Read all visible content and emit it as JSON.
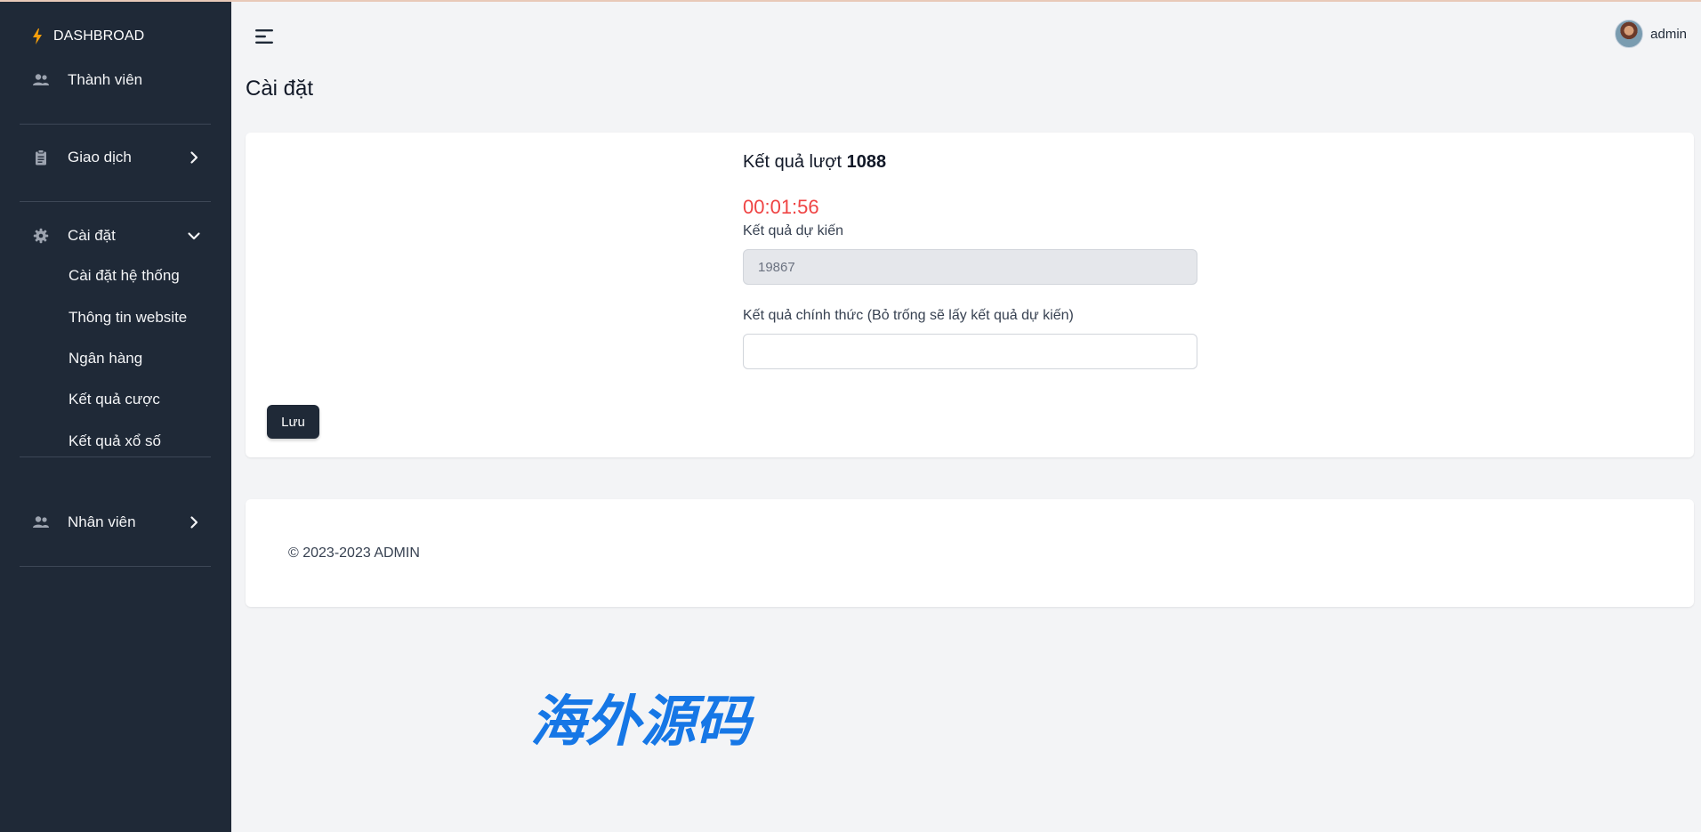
{
  "sidebar": {
    "brand": "DASHBROAD",
    "items": [
      {
        "label": "Thành viên",
        "icon": "users-icon"
      },
      {
        "label": "Giao dịch",
        "icon": "clipboard-icon",
        "chevron": "chevron-right-icon"
      },
      {
        "label": "Cài đặt",
        "icon": "gear-icon",
        "chevron": "chevron-down-icon",
        "children": [
          "Cài đặt hệ thống",
          "Thông tin website",
          "Ngân hàng",
          "Kết quả cược",
          "Kết quả xổ số"
        ]
      },
      {
        "label": "Nhân viên",
        "icon": "users-icon",
        "chevron": "chevron-right-icon"
      }
    ]
  },
  "header": {
    "user_name": "admin"
  },
  "page": {
    "title": "Cài đặt"
  },
  "result_card": {
    "title_prefix": "Kết quả lượt",
    "round_number": "1088",
    "countdown": "00:01:56",
    "expected_label": "Kết quả dự kiến",
    "expected_value": "19867",
    "official_label": "Kết quả chính thức (Bỏ trống sẽ lấy kết quả dự kiến)",
    "official_value": "",
    "save_label": "Lưu"
  },
  "footer": {
    "text": "© 2023-2023 ADMIN"
  },
  "watermark": {
    "text": "海外源码"
  },
  "colors": {
    "sidebar_bg": "#1f2937",
    "page_bg": "#f3f4f6",
    "countdown": "#ef4444",
    "brand_bolt": "#f59e0b",
    "watermark": "#1677e6"
  }
}
